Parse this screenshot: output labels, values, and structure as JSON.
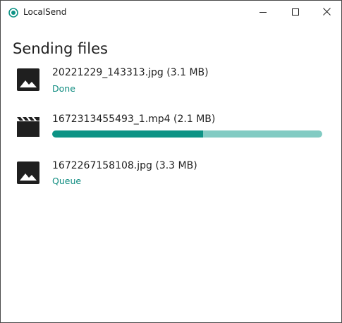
{
  "window": {
    "title": "LocalSend",
    "accent_color": "#0d9385"
  },
  "page": {
    "title": "Sending files"
  },
  "files": [
    {
      "icon": "image-icon",
      "name": "20221229_143313.jpg (3.1 MB)",
      "status": "Done"
    },
    {
      "icon": "video-icon",
      "name": "1672313455493_1.mp4 (2.1 MB)",
      "progress": 0.56
    },
    {
      "icon": "image-icon",
      "name": "1672267158108.jpg (3.3 MB)",
      "status": "Queue"
    }
  ]
}
